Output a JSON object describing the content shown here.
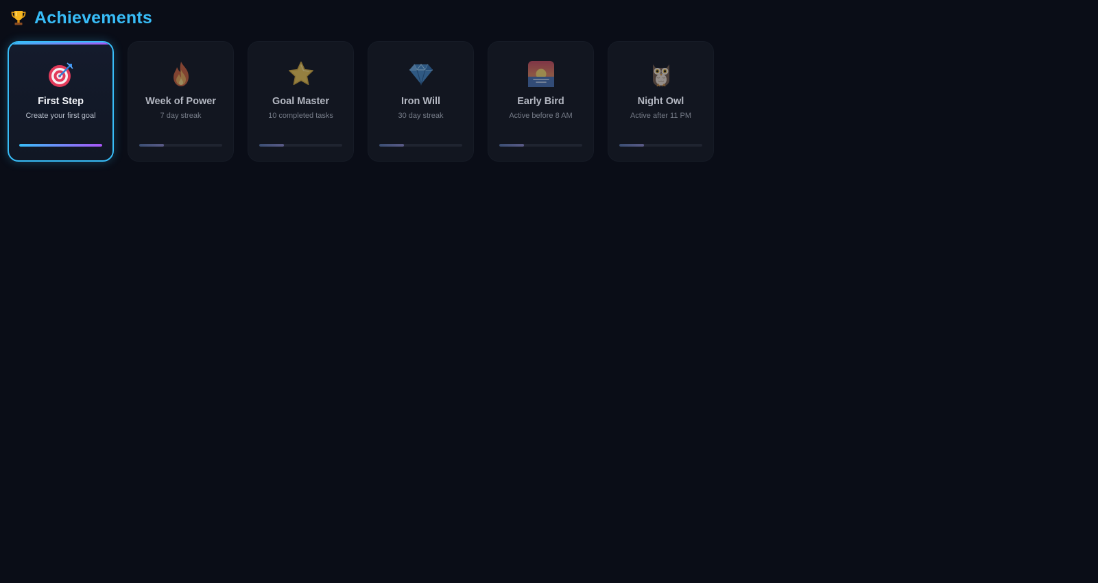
{
  "header": {
    "title": "Achievements",
    "icon": "trophy-icon"
  },
  "colors": {
    "accent": "#38bdf8",
    "accent_secondary": "#a855f7",
    "background": "#0a0d17",
    "card_background": "#121620"
  },
  "achievements": [
    {
      "id": "first-step",
      "title": "First Step",
      "description": "Create your first goal",
      "icon": "target-icon",
      "unlocked": true,
      "progress": 1.0
    },
    {
      "id": "week-of-power",
      "title": "Week of Power",
      "description": "7 day streak",
      "icon": "fire-icon",
      "unlocked": false,
      "progress": 0.3
    },
    {
      "id": "goal-master",
      "title": "Goal Master",
      "description": "10 completed tasks",
      "icon": "star-icon",
      "unlocked": false,
      "progress": 0.3
    },
    {
      "id": "iron-will",
      "title": "Iron Will",
      "description": "30 day streak",
      "icon": "diamond-icon",
      "unlocked": false,
      "progress": 0.3
    },
    {
      "id": "early-bird",
      "title": "Early Bird",
      "description": "Active before 8 AM",
      "icon": "sunrise-icon",
      "unlocked": false,
      "progress": 0.3
    },
    {
      "id": "night-owl",
      "title": "Night Owl",
      "description": "Active after 11 PM",
      "icon": "owl-icon",
      "unlocked": false,
      "progress": 0.3
    }
  ]
}
